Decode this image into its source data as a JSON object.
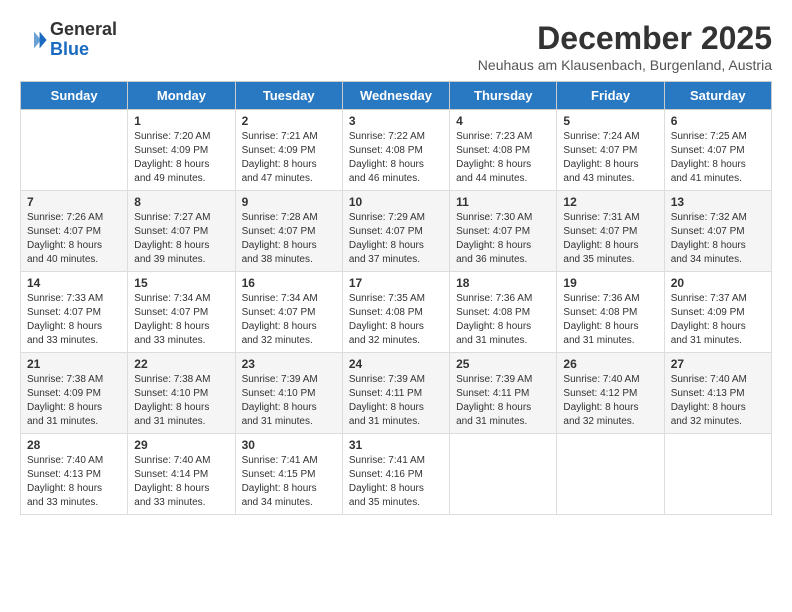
{
  "logo": {
    "general": "General",
    "blue": "Blue"
  },
  "title": "December 2025",
  "subtitle": "Neuhaus am Klausenbach, Burgenland, Austria",
  "calendar": {
    "headers": [
      "Sunday",
      "Monday",
      "Tuesday",
      "Wednesday",
      "Thursday",
      "Friday",
      "Saturday"
    ],
    "weeks": [
      [
        {
          "day": "",
          "sunrise": "",
          "sunset": "",
          "daylight": ""
        },
        {
          "day": "1",
          "sunrise": "Sunrise: 7:20 AM",
          "sunset": "Sunset: 4:09 PM",
          "daylight": "Daylight: 8 hours and 49 minutes."
        },
        {
          "day": "2",
          "sunrise": "Sunrise: 7:21 AM",
          "sunset": "Sunset: 4:09 PM",
          "daylight": "Daylight: 8 hours and 47 minutes."
        },
        {
          "day": "3",
          "sunrise": "Sunrise: 7:22 AM",
          "sunset": "Sunset: 4:08 PM",
          "daylight": "Daylight: 8 hours and 46 minutes."
        },
        {
          "day": "4",
          "sunrise": "Sunrise: 7:23 AM",
          "sunset": "Sunset: 4:08 PM",
          "daylight": "Daylight: 8 hours and 44 minutes."
        },
        {
          "day": "5",
          "sunrise": "Sunrise: 7:24 AM",
          "sunset": "Sunset: 4:07 PM",
          "daylight": "Daylight: 8 hours and 43 minutes."
        },
        {
          "day": "6",
          "sunrise": "Sunrise: 7:25 AM",
          "sunset": "Sunset: 4:07 PM",
          "daylight": "Daylight: 8 hours and 41 minutes."
        }
      ],
      [
        {
          "day": "7",
          "sunrise": "Sunrise: 7:26 AM",
          "sunset": "Sunset: 4:07 PM",
          "daylight": "Daylight: 8 hours and 40 minutes."
        },
        {
          "day": "8",
          "sunrise": "Sunrise: 7:27 AM",
          "sunset": "Sunset: 4:07 PM",
          "daylight": "Daylight: 8 hours and 39 minutes."
        },
        {
          "day": "9",
          "sunrise": "Sunrise: 7:28 AM",
          "sunset": "Sunset: 4:07 PM",
          "daylight": "Daylight: 8 hours and 38 minutes."
        },
        {
          "day": "10",
          "sunrise": "Sunrise: 7:29 AM",
          "sunset": "Sunset: 4:07 PM",
          "daylight": "Daylight: 8 hours and 37 minutes."
        },
        {
          "day": "11",
          "sunrise": "Sunrise: 7:30 AM",
          "sunset": "Sunset: 4:07 PM",
          "daylight": "Daylight: 8 hours and 36 minutes."
        },
        {
          "day": "12",
          "sunrise": "Sunrise: 7:31 AM",
          "sunset": "Sunset: 4:07 PM",
          "daylight": "Daylight: 8 hours and 35 minutes."
        },
        {
          "day": "13",
          "sunrise": "Sunrise: 7:32 AM",
          "sunset": "Sunset: 4:07 PM",
          "daylight": "Daylight: 8 hours and 34 minutes."
        }
      ],
      [
        {
          "day": "14",
          "sunrise": "Sunrise: 7:33 AM",
          "sunset": "Sunset: 4:07 PM",
          "daylight": "Daylight: 8 hours and 33 minutes."
        },
        {
          "day": "15",
          "sunrise": "Sunrise: 7:34 AM",
          "sunset": "Sunset: 4:07 PM",
          "daylight": "Daylight: 8 hours and 33 minutes."
        },
        {
          "day": "16",
          "sunrise": "Sunrise: 7:34 AM",
          "sunset": "Sunset: 4:07 PM",
          "daylight": "Daylight: 8 hours and 32 minutes."
        },
        {
          "day": "17",
          "sunrise": "Sunrise: 7:35 AM",
          "sunset": "Sunset: 4:08 PM",
          "daylight": "Daylight: 8 hours and 32 minutes."
        },
        {
          "day": "18",
          "sunrise": "Sunrise: 7:36 AM",
          "sunset": "Sunset: 4:08 PM",
          "daylight": "Daylight: 8 hours and 31 minutes."
        },
        {
          "day": "19",
          "sunrise": "Sunrise: 7:36 AM",
          "sunset": "Sunset: 4:08 PM",
          "daylight": "Daylight: 8 hours and 31 minutes."
        },
        {
          "day": "20",
          "sunrise": "Sunrise: 7:37 AM",
          "sunset": "Sunset: 4:09 PM",
          "daylight": "Daylight: 8 hours and 31 minutes."
        }
      ],
      [
        {
          "day": "21",
          "sunrise": "Sunrise: 7:38 AM",
          "sunset": "Sunset: 4:09 PM",
          "daylight": "Daylight: 8 hours and 31 minutes."
        },
        {
          "day": "22",
          "sunrise": "Sunrise: 7:38 AM",
          "sunset": "Sunset: 4:10 PM",
          "daylight": "Daylight: 8 hours and 31 minutes."
        },
        {
          "day": "23",
          "sunrise": "Sunrise: 7:39 AM",
          "sunset": "Sunset: 4:10 PM",
          "daylight": "Daylight: 8 hours and 31 minutes."
        },
        {
          "day": "24",
          "sunrise": "Sunrise: 7:39 AM",
          "sunset": "Sunset: 4:11 PM",
          "daylight": "Daylight: 8 hours and 31 minutes."
        },
        {
          "day": "25",
          "sunrise": "Sunrise: 7:39 AM",
          "sunset": "Sunset: 4:11 PM",
          "daylight": "Daylight: 8 hours and 31 minutes."
        },
        {
          "day": "26",
          "sunrise": "Sunrise: 7:40 AM",
          "sunset": "Sunset: 4:12 PM",
          "daylight": "Daylight: 8 hours and 32 minutes."
        },
        {
          "day": "27",
          "sunrise": "Sunrise: 7:40 AM",
          "sunset": "Sunset: 4:13 PM",
          "daylight": "Daylight: 8 hours and 32 minutes."
        }
      ],
      [
        {
          "day": "28",
          "sunrise": "Sunrise: 7:40 AM",
          "sunset": "Sunset: 4:13 PM",
          "daylight": "Daylight: 8 hours and 33 minutes."
        },
        {
          "day": "29",
          "sunrise": "Sunrise: 7:40 AM",
          "sunset": "Sunset: 4:14 PM",
          "daylight": "Daylight: 8 hours and 33 minutes."
        },
        {
          "day": "30",
          "sunrise": "Sunrise: 7:41 AM",
          "sunset": "Sunset: 4:15 PM",
          "daylight": "Daylight: 8 hours and 34 minutes."
        },
        {
          "day": "31",
          "sunrise": "Sunrise: 7:41 AM",
          "sunset": "Sunset: 4:16 PM",
          "daylight": "Daylight: 8 hours and 35 minutes."
        },
        {
          "day": "",
          "sunrise": "",
          "sunset": "",
          "daylight": ""
        },
        {
          "day": "",
          "sunrise": "",
          "sunset": "",
          "daylight": ""
        },
        {
          "day": "",
          "sunrise": "",
          "sunset": "",
          "daylight": ""
        }
      ]
    ]
  }
}
